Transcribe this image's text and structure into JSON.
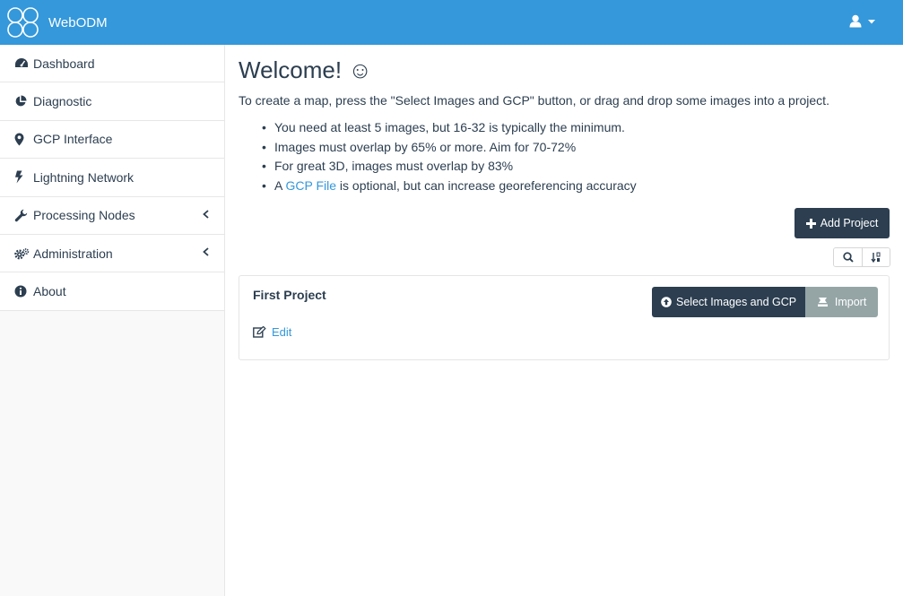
{
  "brand": {
    "name": "WebODM"
  },
  "sidebar": {
    "items": [
      {
        "label": "Dashboard",
        "icon": "dashboard-icon"
      },
      {
        "label": "Diagnostic",
        "icon": "pie-chart-icon"
      },
      {
        "label": "GCP Interface",
        "icon": "map-marker-icon"
      },
      {
        "label": "Lightning Network",
        "icon": "bolt-icon"
      },
      {
        "label": "Processing Nodes",
        "icon": "wrench-icon",
        "expandable": true
      },
      {
        "label": "Administration",
        "icon": "gears-icon",
        "expandable": true
      },
      {
        "label": "About",
        "icon": "info-icon"
      }
    ]
  },
  "main": {
    "title": "Welcome! ☺",
    "intro": "To create a map, press the \"Select Images and GCP\" button, or drag and drop some images into a project.",
    "tips": [
      "You need at least 5 images, but 16-32 is typically the minimum.",
      "Images must overlap by 65% or more. Aim for 70-72%",
      "For great 3D, images must overlap by 83%"
    ],
    "gcp_tip": {
      "prefix": "A ",
      "link": "GCP File",
      "suffix": " is optional, but can increase georeferencing accuracy"
    },
    "add_project_label": "Add Project"
  },
  "project": {
    "name": "First Project",
    "select_label": "Select Images and GCP",
    "import_label": "Import",
    "edit_label": "Edit"
  },
  "colors": {
    "navbar": "#3498db",
    "primary_dark": "#2c3e50",
    "import_gray": "#95a5a6",
    "link": "#3498db"
  }
}
